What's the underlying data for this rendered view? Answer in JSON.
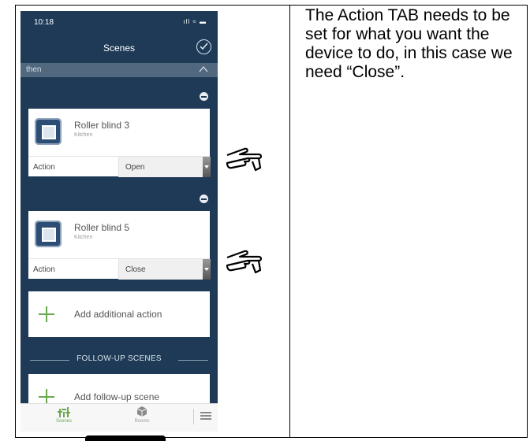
{
  "statusbar": {
    "time": "10:18",
    "indicators": "ıll ≈ ▬"
  },
  "navbar": {
    "title": "Scenes"
  },
  "section": {
    "label": "then"
  },
  "actions": [
    {
      "device": "Roller blind 3",
      "room": "Kitchen",
      "action_label": "Action",
      "action_value": "Open"
    },
    {
      "device": "Roller blind 5",
      "room": "Kitchen",
      "action_label": "Action",
      "action_value": "Close"
    }
  ],
  "add_action": {
    "label": "Add additional action"
  },
  "followup": {
    "heading": "FOLLOW-UP SCENES",
    "add_label": "Add follow-up scene"
  },
  "tabs": [
    {
      "label": "Scenes",
      "active": true
    },
    {
      "label": "Rooms",
      "active": false
    }
  ],
  "colors": {
    "background": "#1e3a57",
    "accent": "#6aa84f",
    "section_bar": "#51687f"
  },
  "explanation": "The Action TAB needs to be set for what you want the device to do, in this case we need “Close”."
}
